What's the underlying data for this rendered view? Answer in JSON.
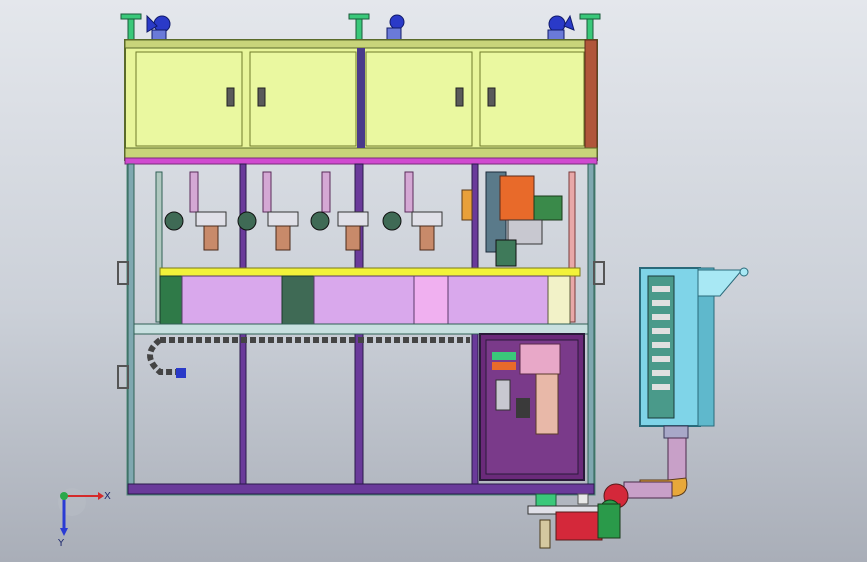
{
  "viewport": {
    "background_top": "#e4e7ec",
    "background_bottom": "#a9aeb8"
  },
  "axes": {
    "x_label": "X",
    "y_label": "Y",
    "x_color": "#d42a2a",
    "y_color": "#2a3bd4",
    "z_color": "#2aa84a"
  },
  "colors": {
    "frame": "#4f8a7a",
    "frame_dark": "#2f5f55",
    "cabinet_panel": "#e8f59a",
    "cabinet_edge": "#6f7a2a",
    "brace_purple": "#6a3a9a",
    "beam_magenta": "#d04ad0",
    "beam_yellow": "#f2f23a",
    "panel_violet": "#d9a8ec",
    "panel_green": "#2f7a48",
    "panel_dark_green": "#3f6a55",
    "control_box": "#6a2a7a",
    "control_box_edge": "#2a1a3a",
    "electric_box": "#7fd4e8",
    "electric_edge": "#2a6a7a",
    "pipe": "#c8a0c8",
    "pump_red": "#d4283a",
    "pump_green": "#2a9a4a",
    "fan_blue": "#2a3ac8",
    "post_green": "#3ac87a",
    "orange_mech": "#e86a2a"
  },
  "icons": {
    "fan": "fan-icon",
    "cabinet_handle": "cabinet-handle-icon",
    "coordinate_triad": "axis-triad-icon"
  }
}
